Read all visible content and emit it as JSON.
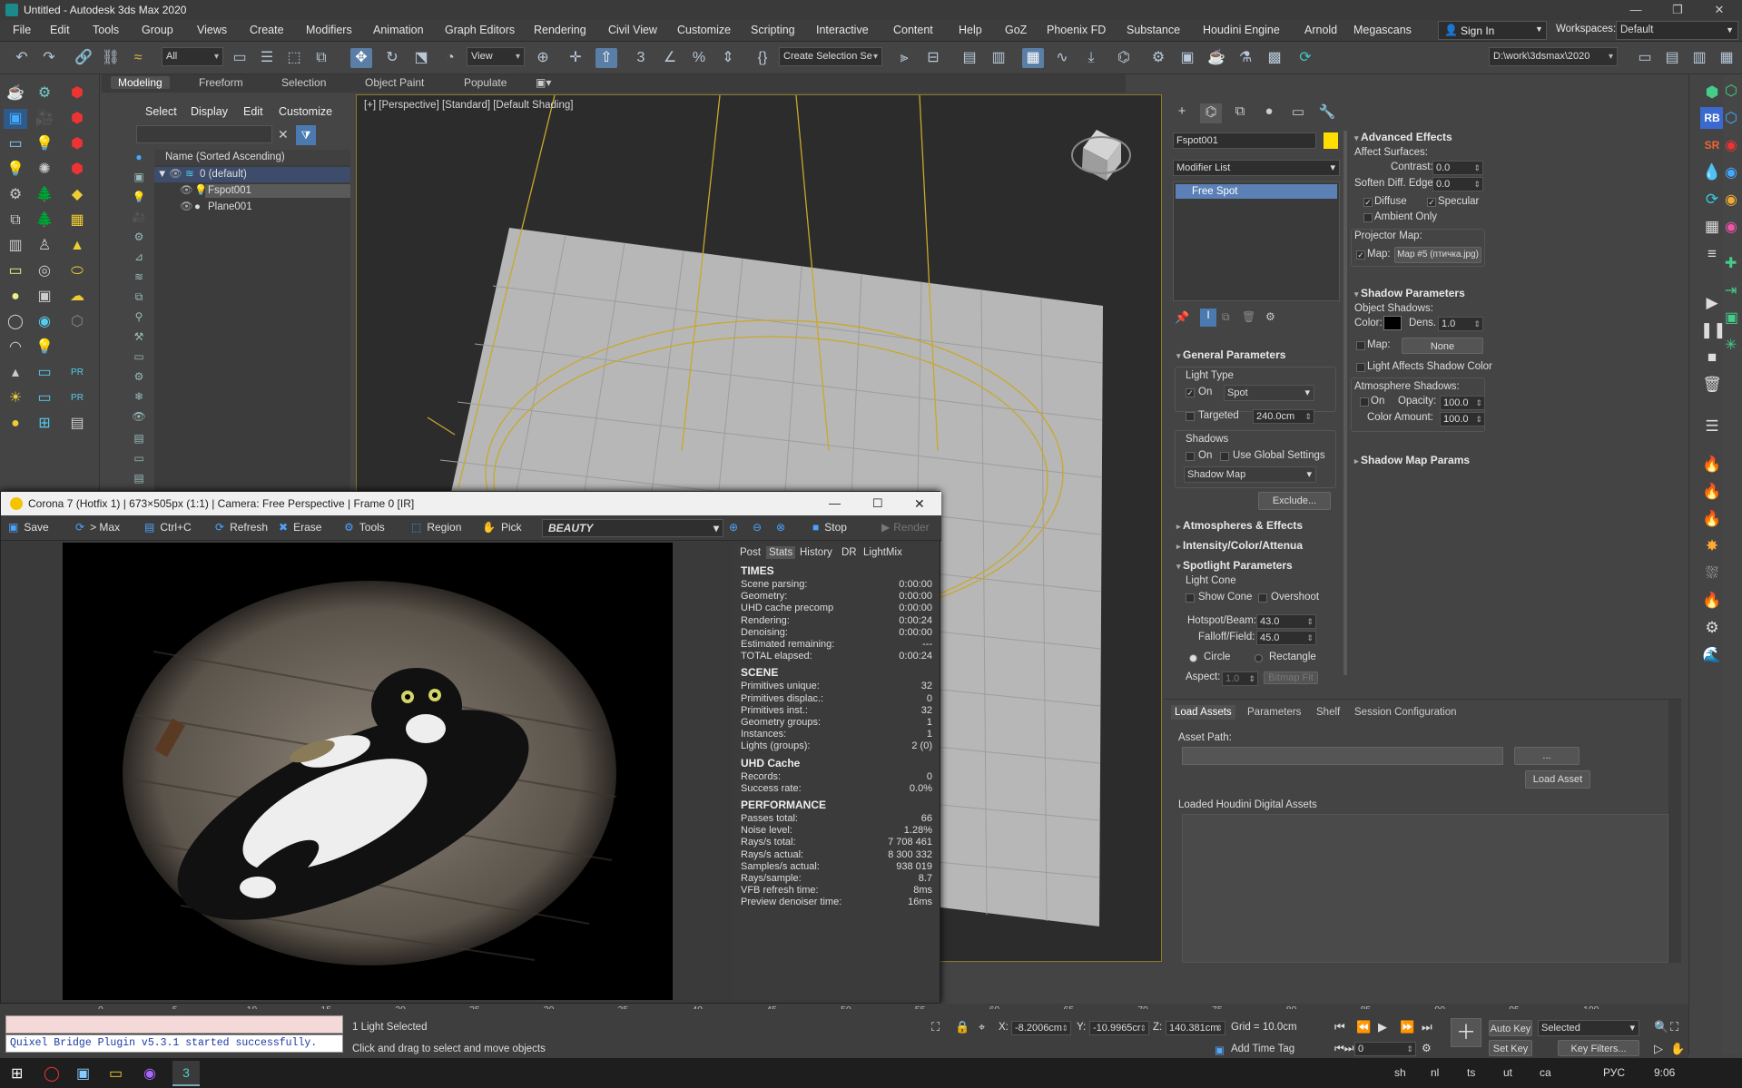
{
  "window": {
    "title": "Untitled - Autodesk 3ds Max 2020"
  },
  "menu": [
    "File",
    "Edit",
    "Tools",
    "Group",
    "Views",
    "Create",
    "Modifiers",
    "Animation",
    "Graph Editors",
    "Rendering",
    "Civil View",
    "Customize",
    "Scripting",
    "Interactive",
    "Content",
    "Help",
    "GoZ",
    "Phoenix FD",
    "Substance",
    "Houdini Engine",
    "Arnold",
    "Megascans"
  ],
  "account": {
    "sign_in": "Sign In",
    "workspaces_label": "Workspaces:",
    "workspace": "Default"
  },
  "toolbar": {
    "filter": "All",
    "coord": "View",
    "selection_set": "Create Selection Se",
    "project_path": "D:\\work\\3dsmax\\2020"
  },
  "ribbon": {
    "tabs": [
      "Modeling",
      "Freeform",
      "Selection",
      "Object Paint",
      "Populate"
    ]
  },
  "scene_explorer": {
    "menu": [
      "Select",
      "Display",
      "Edit",
      "Customize"
    ],
    "column": "Name (Sorted Ascending)",
    "rows": [
      "0 (default)",
      "Fspot001",
      "Plane001"
    ]
  },
  "viewport": {
    "label": "[+] [Perspective] [Standard] [Default Shading]"
  },
  "command_panel": {
    "object_name": "Fspot001",
    "object_color": "#ffdd00",
    "modifier_list": "Modifier List",
    "stack": [
      "Free Spot"
    ],
    "general": {
      "title": "General Parameters",
      "light_type": "Light Type",
      "on": "On",
      "type": "Spot",
      "targeted": "Targeted",
      "target_dist": "240.0cm",
      "shadows": "Shadows",
      "shadows_on": "On",
      "global": "Use Global Settings",
      "shadow_type": "Shadow Map",
      "exclude": "Exclude..."
    },
    "atmos": "Atmospheres & Effects",
    "intensity": "Intensity/Color/Attenua",
    "spot": {
      "title": "Spotlight Parameters",
      "cone": "Light Cone",
      "show_cone": "Show Cone",
      "overshoot": "Overshoot",
      "hotspot_label": "Hotspot/Beam:",
      "hotspot": "43.0",
      "falloff_label": "Falloff/Field:",
      "falloff": "45.0",
      "circle": "Circle",
      "rectangle": "Rectangle",
      "aspect_label": "Aspect:",
      "aspect": "1.0",
      "bitmap_fit": "Bitmap Fit"
    },
    "advanced": {
      "title": "Advanced Effects",
      "affect": "Affect Surfaces:",
      "contrast_label": "Contrast:",
      "contrast": "0.0",
      "soften_label": "Soften Diff. Edge:",
      "soften": "0.0",
      "diffuse": "Diffuse",
      "specular": "Specular",
      "ambient": "Ambient Only",
      "projector": "Projector Map:",
      "map_label": "Map:",
      "map_value": "Map #5 (птичка.jpg)"
    },
    "shadow_params": {
      "title": "Shadow Parameters",
      "object_shadows": "Object Shadows:",
      "color_label": "Color:",
      "dens_label": "Dens.",
      "dens": "1.0",
      "map_label": "Map:",
      "map_value": "None",
      "light_affects": "Light Affects Shadow Color",
      "atmo": "Atmosphere Shadows:",
      "atmo_on": "On",
      "opacity_label": "Opacity:",
      "opacity": "100.0",
      "coloramt_label": "Color Amount:",
      "coloramt": "100.0"
    },
    "shadow_map": "Shadow Map Params"
  },
  "houdini": {
    "tabs": [
      "Load Assets",
      "Parameters",
      "Shelf",
      "Session Configuration"
    ],
    "asset_path": "Asset Path:",
    "browse": "...",
    "load": "Load Asset",
    "loaded": "Loaded Houdini Digital Assets"
  },
  "vfb": {
    "title": "Corona 7 (Hotfix 1) | 673×505px (1:1) | Camera: Free Perspective | Frame 0 [IR]",
    "toolbar": [
      "Save",
      "> Max",
      "Ctrl+C",
      "Refresh",
      "Erase",
      "Tools",
      "Region",
      "Pick"
    ],
    "channel": "BEAUTY",
    "stop": "Stop",
    "render": "Render",
    "stat_tabs": [
      "Post",
      "Stats",
      "History",
      "DR",
      "LightMix"
    ],
    "times_h": "TIMES",
    "times": [
      [
        "Scene parsing:",
        "0:00:00"
      ],
      [
        "Geometry:",
        "0:00:00"
      ],
      [
        "UHD cache precomp",
        "0:00:00"
      ],
      [
        "Rendering:",
        "0:00:24"
      ],
      [
        "Denoising:",
        "0:00:00"
      ],
      [
        "Estimated remaining:",
        "---"
      ],
      [
        "TOTAL elapsed:",
        "0:00:24"
      ]
    ],
    "scene_h": "SCENE",
    "scene": [
      [
        "Primitives unique:",
        "32"
      ],
      [
        "Primitives displac.:",
        "0"
      ],
      [
        "Primitives inst.:",
        "32"
      ],
      [
        "Geometry groups:",
        "1"
      ],
      [
        "Instances:",
        "1"
      ],
      [
        "Lights (groups):",
        "2 (0)"
      ]
    ],
    "uhd_h": "UHD Cache",
    "uhd": [
      [
        "Records:",
        "0"
      ],
      [
        "Success rate:",
        "0.0%"
      ]
    ],
    "perf_h": "PERFORMANCE",
    "perf": [
      [
        "Passes total:",
        "66"
      ],
      [
        "Noise level:",
        "1.28%"
      ],
      [
        "Rays/s total:",
        "7 708 461"
      ],
      [
        "Rays/s actual:",
        "8 300 332"
      ],
      [
        "Samples/s actual:",
        "938 019"
      ],
      [
        "Rays/sample:",
        "8.7"
      ],
      [
        "VFB refresh time:",
        "8ms"
      ],
      [
        "Preview denoiser time:",
        "16ms"
      ]
    ]
  },
  "timeline": {
    "ticks": [
      "0",
      "5",
      "10",
      "15",
      "20",
      "25",
      "30",
      "35",
      "40",
      "45",
      "50",
      "55",
      "60",
      "65",
      "70",
      "75",
      "80",
      "85",
      "90",
      "95",
      "100"
    ]
  },
  "status": {
    "maxscript_out": "Quixel Bridge Plugin v5.3.1 started successfully.",
    "selected": "1 Light Selected",
    "prompt": "Click and drag to select and move objects",
    "x_label": "X:",
    "x": "-8.2006cm",
    "y_label": "Y:",
    "y": "-10.9965cr",
    "z_label": "Z:",
    "z": "140.381cm",
    "grid": "Grid = 10.0cm",
    "add_time_tag": "Add Time Tag",
    "frame": "0",
    "auto_key": "Auto Key",
    "set_key": "Set Key",
    "key_mode": "Selected",
    "key_filters": "Key Filters..."
  },
  "taskbar": {
    "tray": [
      "sh",
      "nl",
      "ts",
      "ut",
      "ca"
    ],
    "lang": "РУС",
    "time": "9:06"
  }
}
